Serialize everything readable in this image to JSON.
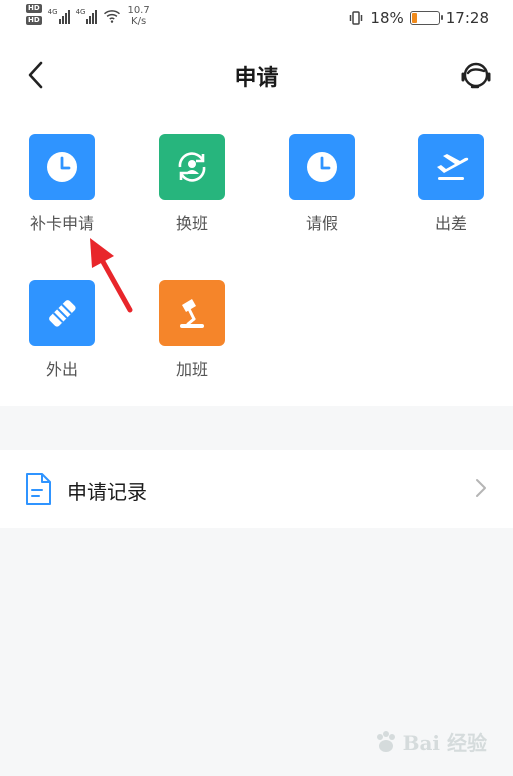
{
  "status_bar": {
    "speed_value": "10.7",
    "speed_unit": "K/s",
    "network_1": "4G",
    "network_2": "4G",
    "hd_1": "HD",
    "hd_2": "HD",
    "battery_percent": "18%",
    "battery_level": 0.18,
    "time": "17:28"
  },
  "header": {
    "title": "申请",
    "back_icon": "chevron-left-icon",
    "service_icon": "customer-service-icon"
  },
  "grid": {
    "items": [
      {
        "label": "补卡申请",
        "icon": "clock-icon",
        "color": "#2f94ff"
      },
      {
        "label": "换班",
        "icon": "swap-person-icon",
        "color": "#27b57d"
      },
      {
        "label": "请假",
        "icon": "clock-icon",
        "color": "#2f94ff"
      },
      {
        "label": "出差",
        "icon": "airplane-icon",
        "color": "#2f94ff"
      },
      {
        "label": "外出",
        "icon": "handshake-icon",
        "color": "#2f94ff"
      },
      {
        "label": "加班",
        "icon": "desk-lamp-icon",
        "color": "#f5852a"
      }
    ]
  },
  "records": {
    "label": "申请记录",
    "icon": "document-icon"
  },
  "annotation": {
    "arrow_color": "#e8262b"
  },
  "watermark": {
    "text": "Bai 经验"
  }
}
